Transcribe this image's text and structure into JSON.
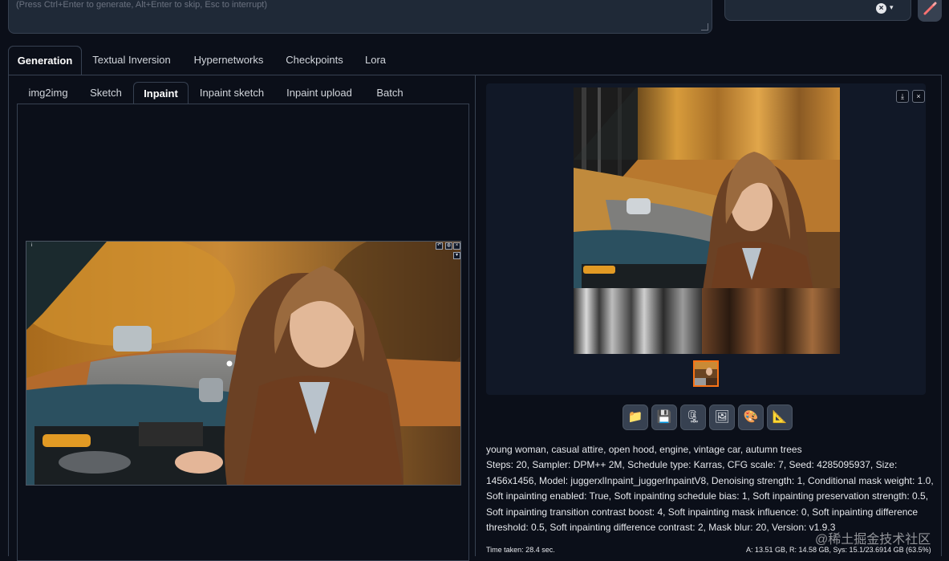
{
  "prompt": {
    "placeholder": "(Press Ctrl+Enter to generate, Alt+Enter to skip, Esc to interrupt)"
  },
  "style_select": {
    "clear": "×",
    "caret": "▾"
  },
  "top_tabs": [
    "Generation",
    "Textual Inversion",
    "Hypernetworks",
    "Checkpoints",
    "Lora"
  ],
  "sub_tabs": [
    "img2img",
    "Sketch",
    "Inpaint",
    "Inpaint sketch",
    "Inpaint upload",
    "Batch"
  ],
  "gallery": {
    "download": "⤓",
    "close": "×"
  },
  "tools": [
    {
      "icon": "folder-icon",
      "glyph": "📁"
    },
    {
      "icon": "save-icon",
      "glyph": "💾"
    },
    {
      "icon": "zip-icon",
      "glyph": "🗜"
    },
    {
      "icon": "image-icon",
      "glyph": "🖼"
    },
    {
      "icon": "palette-icon",
      "glyph": "🎨"
    },
    {
      "icon": "ruler-icon",
      "glyph": "📐"
    }
  ],
  "info": {
    "prompt": "young woman, casual attire, open hood, engine, vintage car, autumn trees",
    "params": "Steps: 20, Sampler: DPM++ 2M, Schedule type: Karras, CFG scale: 7, Seed: 4285095937, Size: 1456x1456, Model: juggerxlInpaint_juggerInpaintV8, Denoising strength: 1, Conditional mask weight: 1.0, Soft inpainting enabled: True, Soft inpainting schedule bias: 1, Soft inpainting preservation strength: 0.5, Soft inpainting transition contrast boost: 4, Soft inpainting mask influence: 0, Soft inpainting difference threshold: 0.5, Soft inpainting difference contrast: 2, Mask blur: 20, Version: v1.9.3"
  },
  "footer": {
    "time_taken": "Time taken: 28.4 sec.",
    "vram": "A: 13.51 GB, R: 14.58 GB, Sys: 15.1/23.6914 GB (63.5%)"
  },
  "watermark": "@稀土掘金技术社区"
}
